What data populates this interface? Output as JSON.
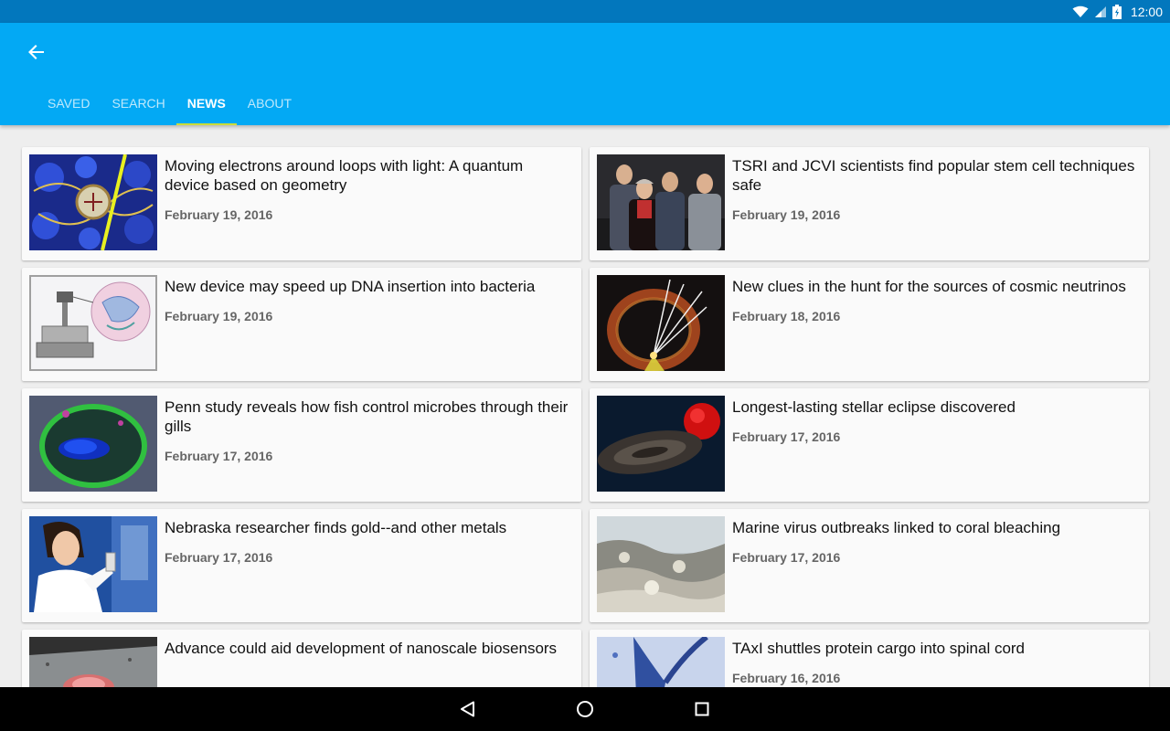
{
  "status": {
    "time": "12:00"
  },
  "tabs": [
    {
      "label": "SAVED"
    },
    {
      "label": "SEARCH"
    },
    {
      "label": "NEWS"
    },
    {
      "label": "ABOUT"
    }
  ],
  "active_tab": "NEWS",
  "articles": [
    {
      "title": "Moving electrons around loops with light: A quantum device based on geometry",
      "date": "February 19, 2016"
    },
    {
      "title": "TSRI and JCVI scientists find popular stem cell techniques safe",
      "date": "February 19, 2016"
    },
    {
      "title": "New device may speed up DNA insertion into bacteria",
      "date": "February 19, 2016"
    },
    {
      "title": "New clues in the hunt for the sources of cosmic neutrinos",
      "date": "February 18, 2016"
    },
    {
      "title": "Penn study reveals how fish control microbes through their gills",
      "date": "February 17, 2016"
    },
    {
      "title": "Longest-lasting stellar eclipse discovered",
      "date": "February 17, 2016"
    },
    {
      "title": "Nebraska researcher finds gold--and other metals",
      "date": "February 17, 2016"
    },
    {
      "title": "Marine virus outbreaks linked to coral bleaching",
      "date": "February 17, 2016"
    },
    {
      "title": "Advance could aid development of nanoscale biosensors",
      "date": ""
    },
    {
      "title": "TAxI shuttles protein cargo into spinal cord",
      "date": "February 16, 2016"
    }
  ],
  "colors": {
    "status_bar": "#0277bd",
    "app_bar": "#03a9f4",
    "tab_indicator": "#cddc39"
  },
  "icons": {
    "back": "arrow-left-icon",
    "wifi": "wifi-icon",
    "signal": "signal-icon",
    "battery": "battery-icon",
    "nav_back": "triangle-back-icon",
    "nav_home": "circle-home-icon",
    "nav_recents": "square-recents-icon"
  }
}
